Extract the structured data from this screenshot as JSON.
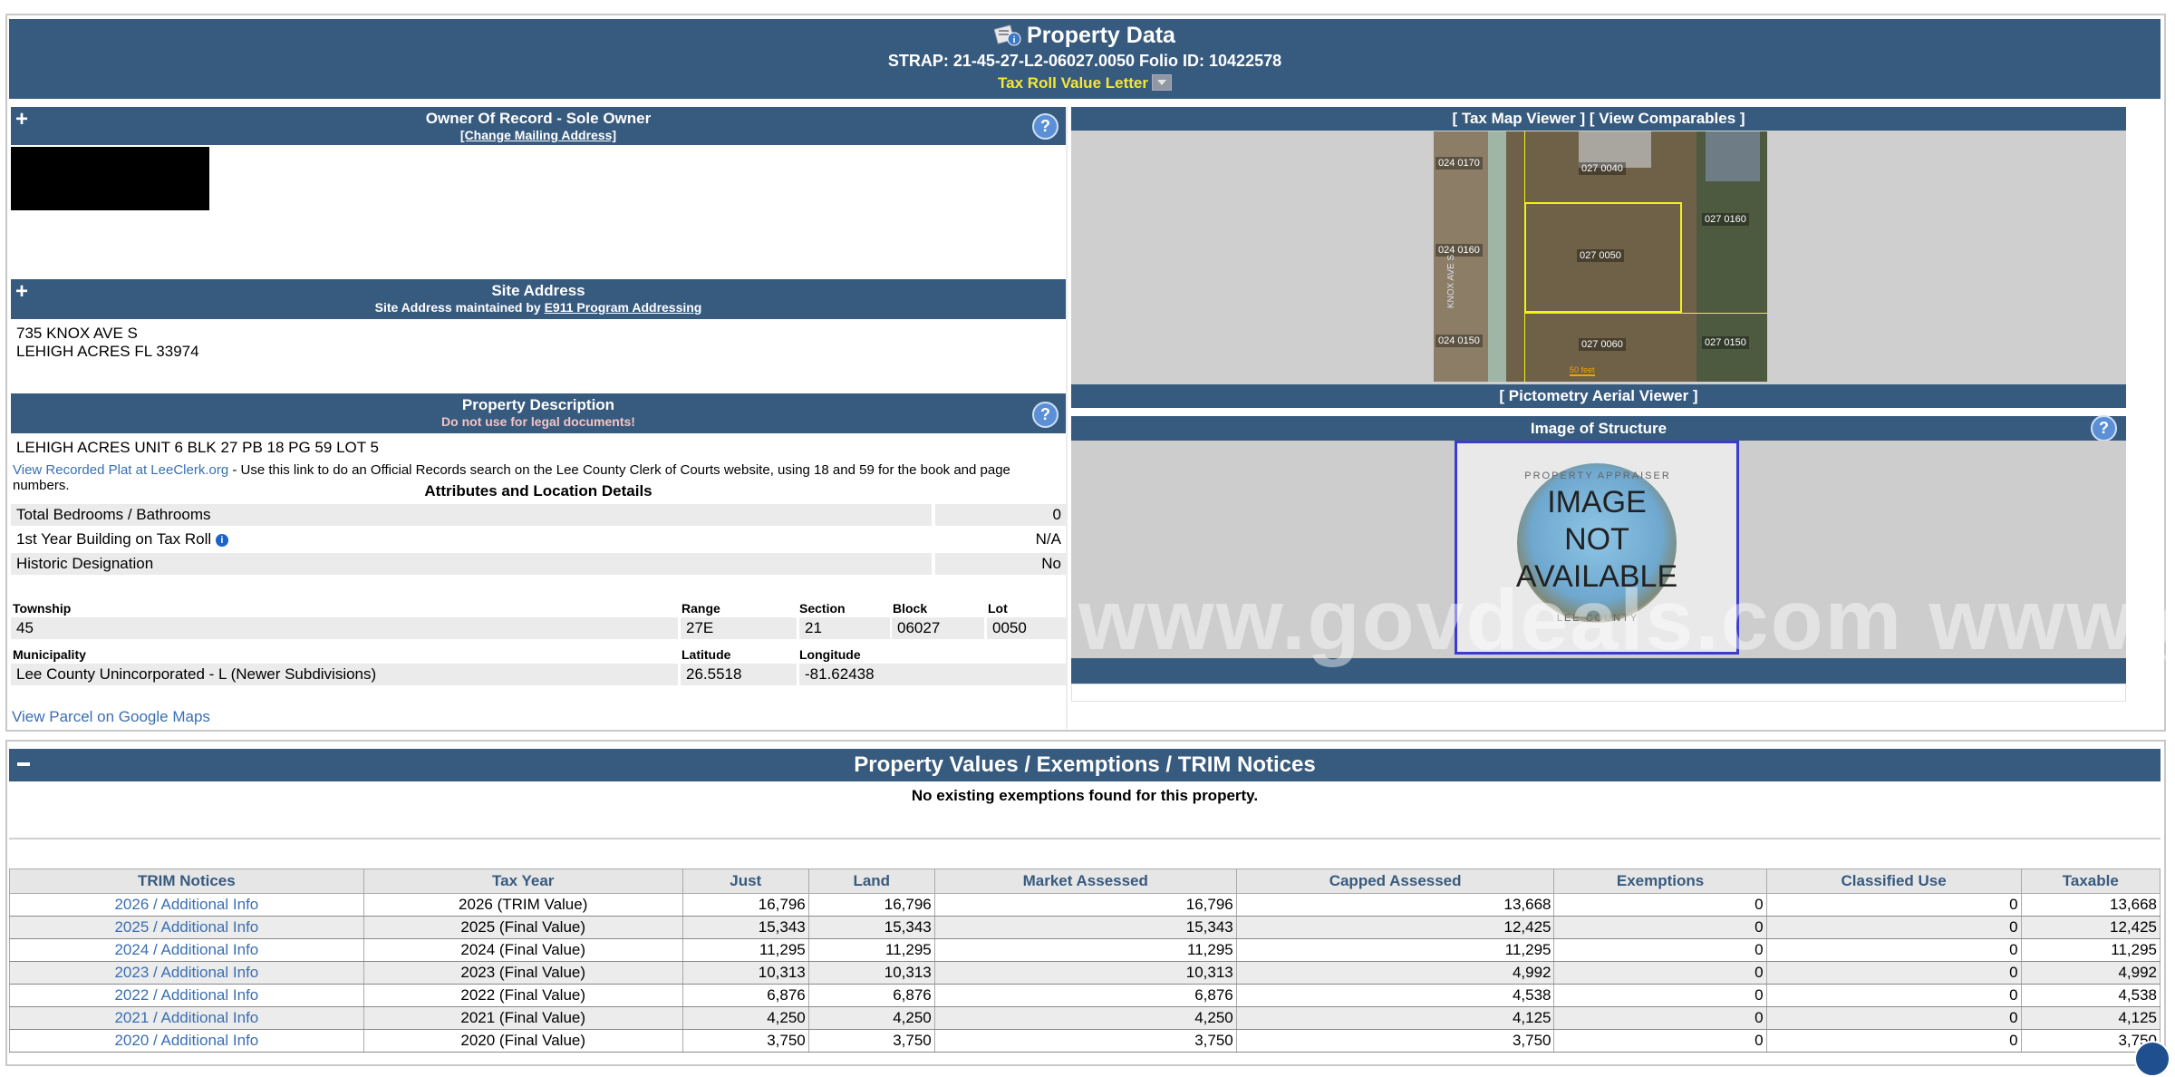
{
  "header": {
    "title": "Property Data",
    "strap": "STRAP: 21-45-27-L2-06027.0050  Folio ID: 10422578",
    "trim_letter": "Tax Roll Value Letter"
  },
  "owner": {
    "title": "Owner Of Record - Sole Owner",
    "change_link": "[Change Mailing Address]"
  },
  "site": {
    "title": "Site Address",
    "subtitle_prefix": "Site Address maintained by ",
    "subtitle_link": "E911 Program Addressing",
    "line1": "735 KNOX AVE S",
    "line2": "LEHIGH ACRES FL 33974"
  },
  "description": {
    "title": "Property Description",
    "warning": "Do not use for legal documents!",
    "legal": "LEHIGH ACRES UNIT 6 BLK 27 PB 18 PG 59 LOT 5",
    "plat_link": "View Recorded Plat at LeeClerk.org",
    "plat_note": " - Use this link to do an Official Records search on the Lee County Clerk of Courts website, using 18 and 59 for the book and page numbers.",
    "attr_heading": "Attributes and Location Details",
    "attributes": [
      {
        "label": "Total Bedrooms / Bathrooms",
        "value": "0"
      },
      {
        "label": "1st Year Building on Tax Roll",
        "value": "N/A"
      },
      {
        "label": "Historic Designation",
        "value": "No"
      }
    ],
    "location_labels": {
      "township": "Township",
      "range": "Range",
      "section": "Section",
      "block": "Block",
      "lot": "Lot",
      "municipality": "Municipality",
      "latitude": "Latitude",
      "longitude": "Longitude"
    },
    "location": {
      "township": "45",
      "range": "27E",
      "section": "21",
      "block": "06027",
      "lot": "0050",
      "municipality": "Lee County Unincorporated - L (Newer Subdivisions)",
      "latitude": "26.5518",
      "longitude": "-81.62438"
    },
    "maps_link": "View Parcel on Google Maps"
  },
  "viewers": {
    "tax_map": "[ Tax Map Viewer ]",
    "comparables": "[ View Comparables ]",
    "pictometry": "[ Pictometry Aerial Viewer ]",
    "image_title": "Image of Structure",
    "image_placeholder": [
      "IMAGE",
      "NOT",
      "AVAILABLE"
    ],
    "seal_top": "PROPERTY APPRAISER",
    "seal_bottom": "LEE COUNTY",
    "watermark": "www.govdeals.com www.gc",
    "map_lots": [
      "024 0170",
      "027 0040",
      "027 0160",
      "024 0160",
      "027 0050",
      "024 0150",
      "027 0060",
      "027 0150"
    ],
    "map_street": "KNOX AVE S",
    "map_scale": "50 feet"
  },
  "values": {
    "title": "Property Values / Exemptions / TRIM Notices",
    "no_exemptions": "No existing exemptions found for this property.",
    "columns": [
      "TRIM Notices",
      "Tax Year",
      "Just",
      "Land",
      "Market Assessed",
      "Capped Assessed",
      "Exemptions",
      "Classified Use",
      "Taxable"
    ],
    "rows": [
      [
        "2026 / Additional Info",
        "2026 (TRIM Value)",
        "16,796",
        "16,796",
        "16,796",
        "13,668",
        "0",
        "0",
        "13,668"
      ],
      [
        "2025 / Additional Info",
        "2025 (Final Value)",
        "15,343",
        "15,343",
        "15,343",
        "12,425",
        "0",
        "0",
        "12,425"
      ],
      [
        "2024 / Additional Info",
        "2024 (Final Value)",
        "11,295",
        "11,295",
        "11,295",
        "11,295",
        "0",
        "0",
        "11,295"
      ],
      [
        "2023 / Additional Info",
        "2023 (Final Value)",
        "10,313",
        "10,313",
        "10,313",
        "4,992",
        "0",
        "0",
        "4,992"
      ],
      [
        "2022 / Additional Info",
        "2022 (Final Value)",
        "6,876",
        "6,876",
        "6,876",
        "4,538",
        "0",
        "0",
        "4,538"
      ],
      [
        "2021 / Additional Info",
        "2021 (Final Value)",
        "4,250",
        "4,250",
        "4,250",
        "4,125",
        "0",
        "0",
        "4,125"
      ],
      [
        "2020 / Additional Info",
        "2020 (Final Value)",
        "3,750",
        "3,750",
        "3,750",
        "3,750",
        "0",
        "0",
        "3,750"
      ]
    ]
  },
  "colors": {
    "header_bg": "#375a7f",
    "link": "#3a6fb0",
    "trim_yellow": "#f6e735"
  }
}
